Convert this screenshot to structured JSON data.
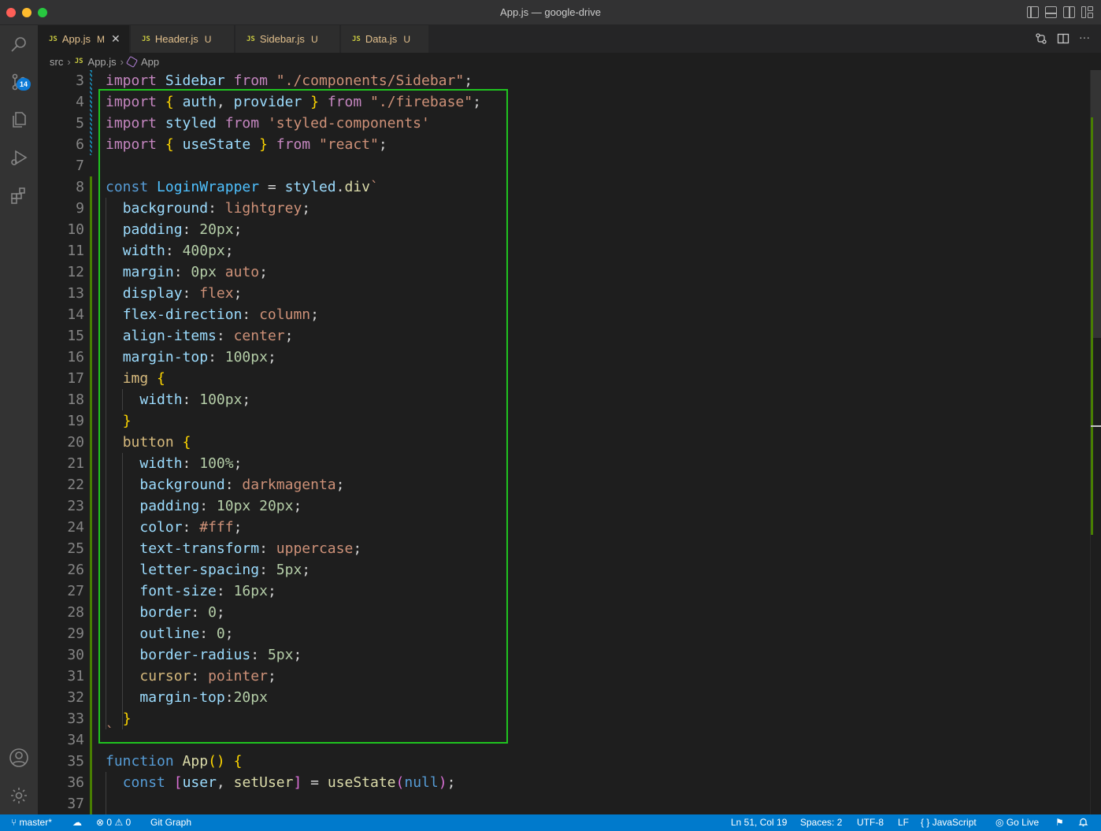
{
  "window": {
    "title": "App.js — google-drive"
  },
  "activity_bar": {
    "source_control_badge": "14"
  },
  "tabs": [
    {
      "file_type": "JS",
      "name": "App.js",
      "status": "M",
      "active": true
    },
    {
      "file_type": "JS",
      "name": "Header.js",
      "status": "U",
      "active": false
    },
    {
      "file_type": "JS",
      "name": "Sidebar.js",
      "status": "U",
      "active": false
    },
    {
      "file_type": "JS",
      "name": "Data.js",
      "status": "U",
      "active": false
    }
  ],
  "breadcrumb": {
    "folder": "src",
    "file_type": "JS",
    "file": "App.js",
    "symbol": "App"
  },
  "editor": {
    "line_numbers": [
      "3",
      "4",
      "5",
      "6",
      "7",
      "8",
      "9",
      "10",
      "11",
      "12",
      "13",
      "14",
      "15",
      "16",
      "17",
      "18",
      "19",
      "20",
      "21",
      "22",
      "23",
      "24",
      "25",
      "26",
      "27",
      "28",
      "29",
      "30",
      "31",
      "32",
      "33",
      "34",
      "35",
      "36",
      "37"
    ]
  },
  "statusbar": {
    "branch": "master*",
    "errors": "0",
    "warnings": "0",
    "git_graph": "Git Graph",
    "cursor": "Ln 51, Col 19",
    "spaces": "Spaces: 2",
    "encoding": "UTF-8",
    "eol": "LF",
    "language": "JavaScript",
    "go_live": "Go Live"
  },
  "colors": {
    "status_bar": "#007acc",
    "highlight_box": "#1fc31f",
    "editor_bg": "#1e1e1e"
  }
}
